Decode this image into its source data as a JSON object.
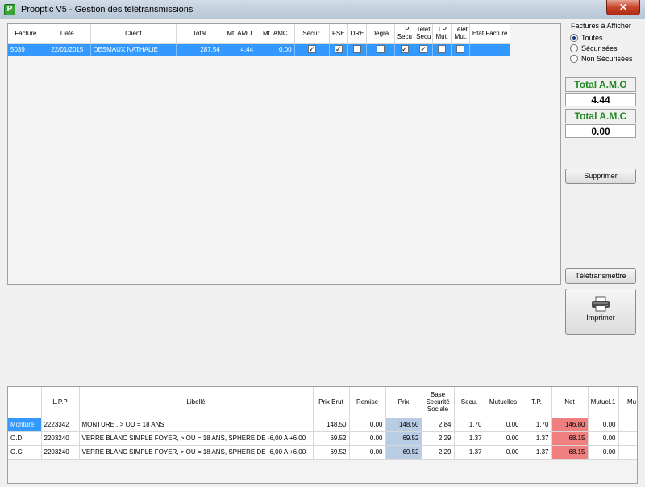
{
  "window": {
    "title": "Prooptic V5 - Gestion des télétransmissions",
    "close_glyph": "✕",
    "app_icon_letter": "P"
  },
  "invoices": {
    "headers": [
      "Facture",
      "Date",
      "Client",
      "Total",
      "Mt. AMO",
      "Mt. AMC",
      "Sécur.",
      "FSE",
      "DRE",
      "Degra.",
      "T.P Secu",
      "Telet Secu",
      "T.P Mut.",
      "Telet Mut.",
      "Etat Facture"
    ],
    "rows": [
      {
        "facture": "5039",
        "date": "22/01/2015",
        "client": "DESMAUX NATHALIE",
        "total": "287.54",
        "mt_amo": "4.44",
        "mt_amc": "0.00",
        "checks": [
          true,
          true,
          false,
          false,
          true,
          true,
          false,
          false
        ],
        "etat": ""
      }
    ]
  },
  "filter": {
    "title": "Factures à Afficher",
    "options": [
      {
        "label": "Toutes",
        "selected": true
      },
      {
        "label": "Sécurisées",
        "selected": false
      },
      {
        "label": "Non Sécurisées",
        "selected": false
      }
    ]
  },
  "totals": {
    "amo_label": "Total A.M.O",
    "amo_value": "4.44",
    "amc_label": "Total A.M.C",
    "amc_value": "0.00",
    "label_color": "#1f8a1f"
  },
  "buttons": {
    "supprimer": "Supprimer",
    "teletransmettre": "Télétransmettre",
    "imprimer": "Imprimer"
  },
  "details": {
    "headers": [
      "",
      "L.P.P",
      "Libellé",
      "Prix Brut",
      "Remise",
      "Prix",
      "Base Securité Sociale",
      "Secu.",
      "Mutuelles",
      "T.P.",
      "Net",
      "Mutuel.1",
      "Mu"
    ],
    "rows": [
      {
        "type": "Monture",
        "lpp": "2223342",
        "libelle": "MONTURE , > OU = 18 ANS",
        "prix_brut": "148.50",
        "remise": "0.00",
        "prix": "148.50",
        "base_ss": "2.84",
        "secu": "1.70",
        "mutuelles": "0.00",
        "tp": "1.70",
        "net": "146.80",
        "mutuel1": "0.00",
        "selected": true
      },
      {
        "type": "O.D",
        "lpp": "2203240",
        "libelle": "VERRE BLANC SIMPLE FOYER, > OU = 18 ANS, SPHERE DE -6,00 A +6,00",
        "prix_brut": "69.52",
        "remise": "0.00",
        "prix": "69.52",
        "base_ss": "2.29",
        "secu": "1.37",
        "mutuelles": "0.00",
        "tp": "1.37",
        "net": "68.15",
        "mutuel1": "0.00",
        "selected": false
      },
      {
        "type": "O.G",
        "lpp": "2203240",
        "libelle": "VERRE BLANC SIMPLE FOYER, > OU = 18 ANS, SPHERE DE -6,00 A +6,00",
        "prix_brut": "69.52",
        "remise": "0.00",
        "prix": "69.52",
        "base_ss": "2.29",
        "secu": "1.37",
        "mutuelles": "0.00",
        "tp": "1.37",
        "net": "68.15",
        "mutuel1": "0.00",
        "selected": false
      }
    ]
  },
  "colors": {
    "selection": "#3399ff",
    "prix_cell": "#b8cce4",
    "net_cell": "#f08080"
  }
}
